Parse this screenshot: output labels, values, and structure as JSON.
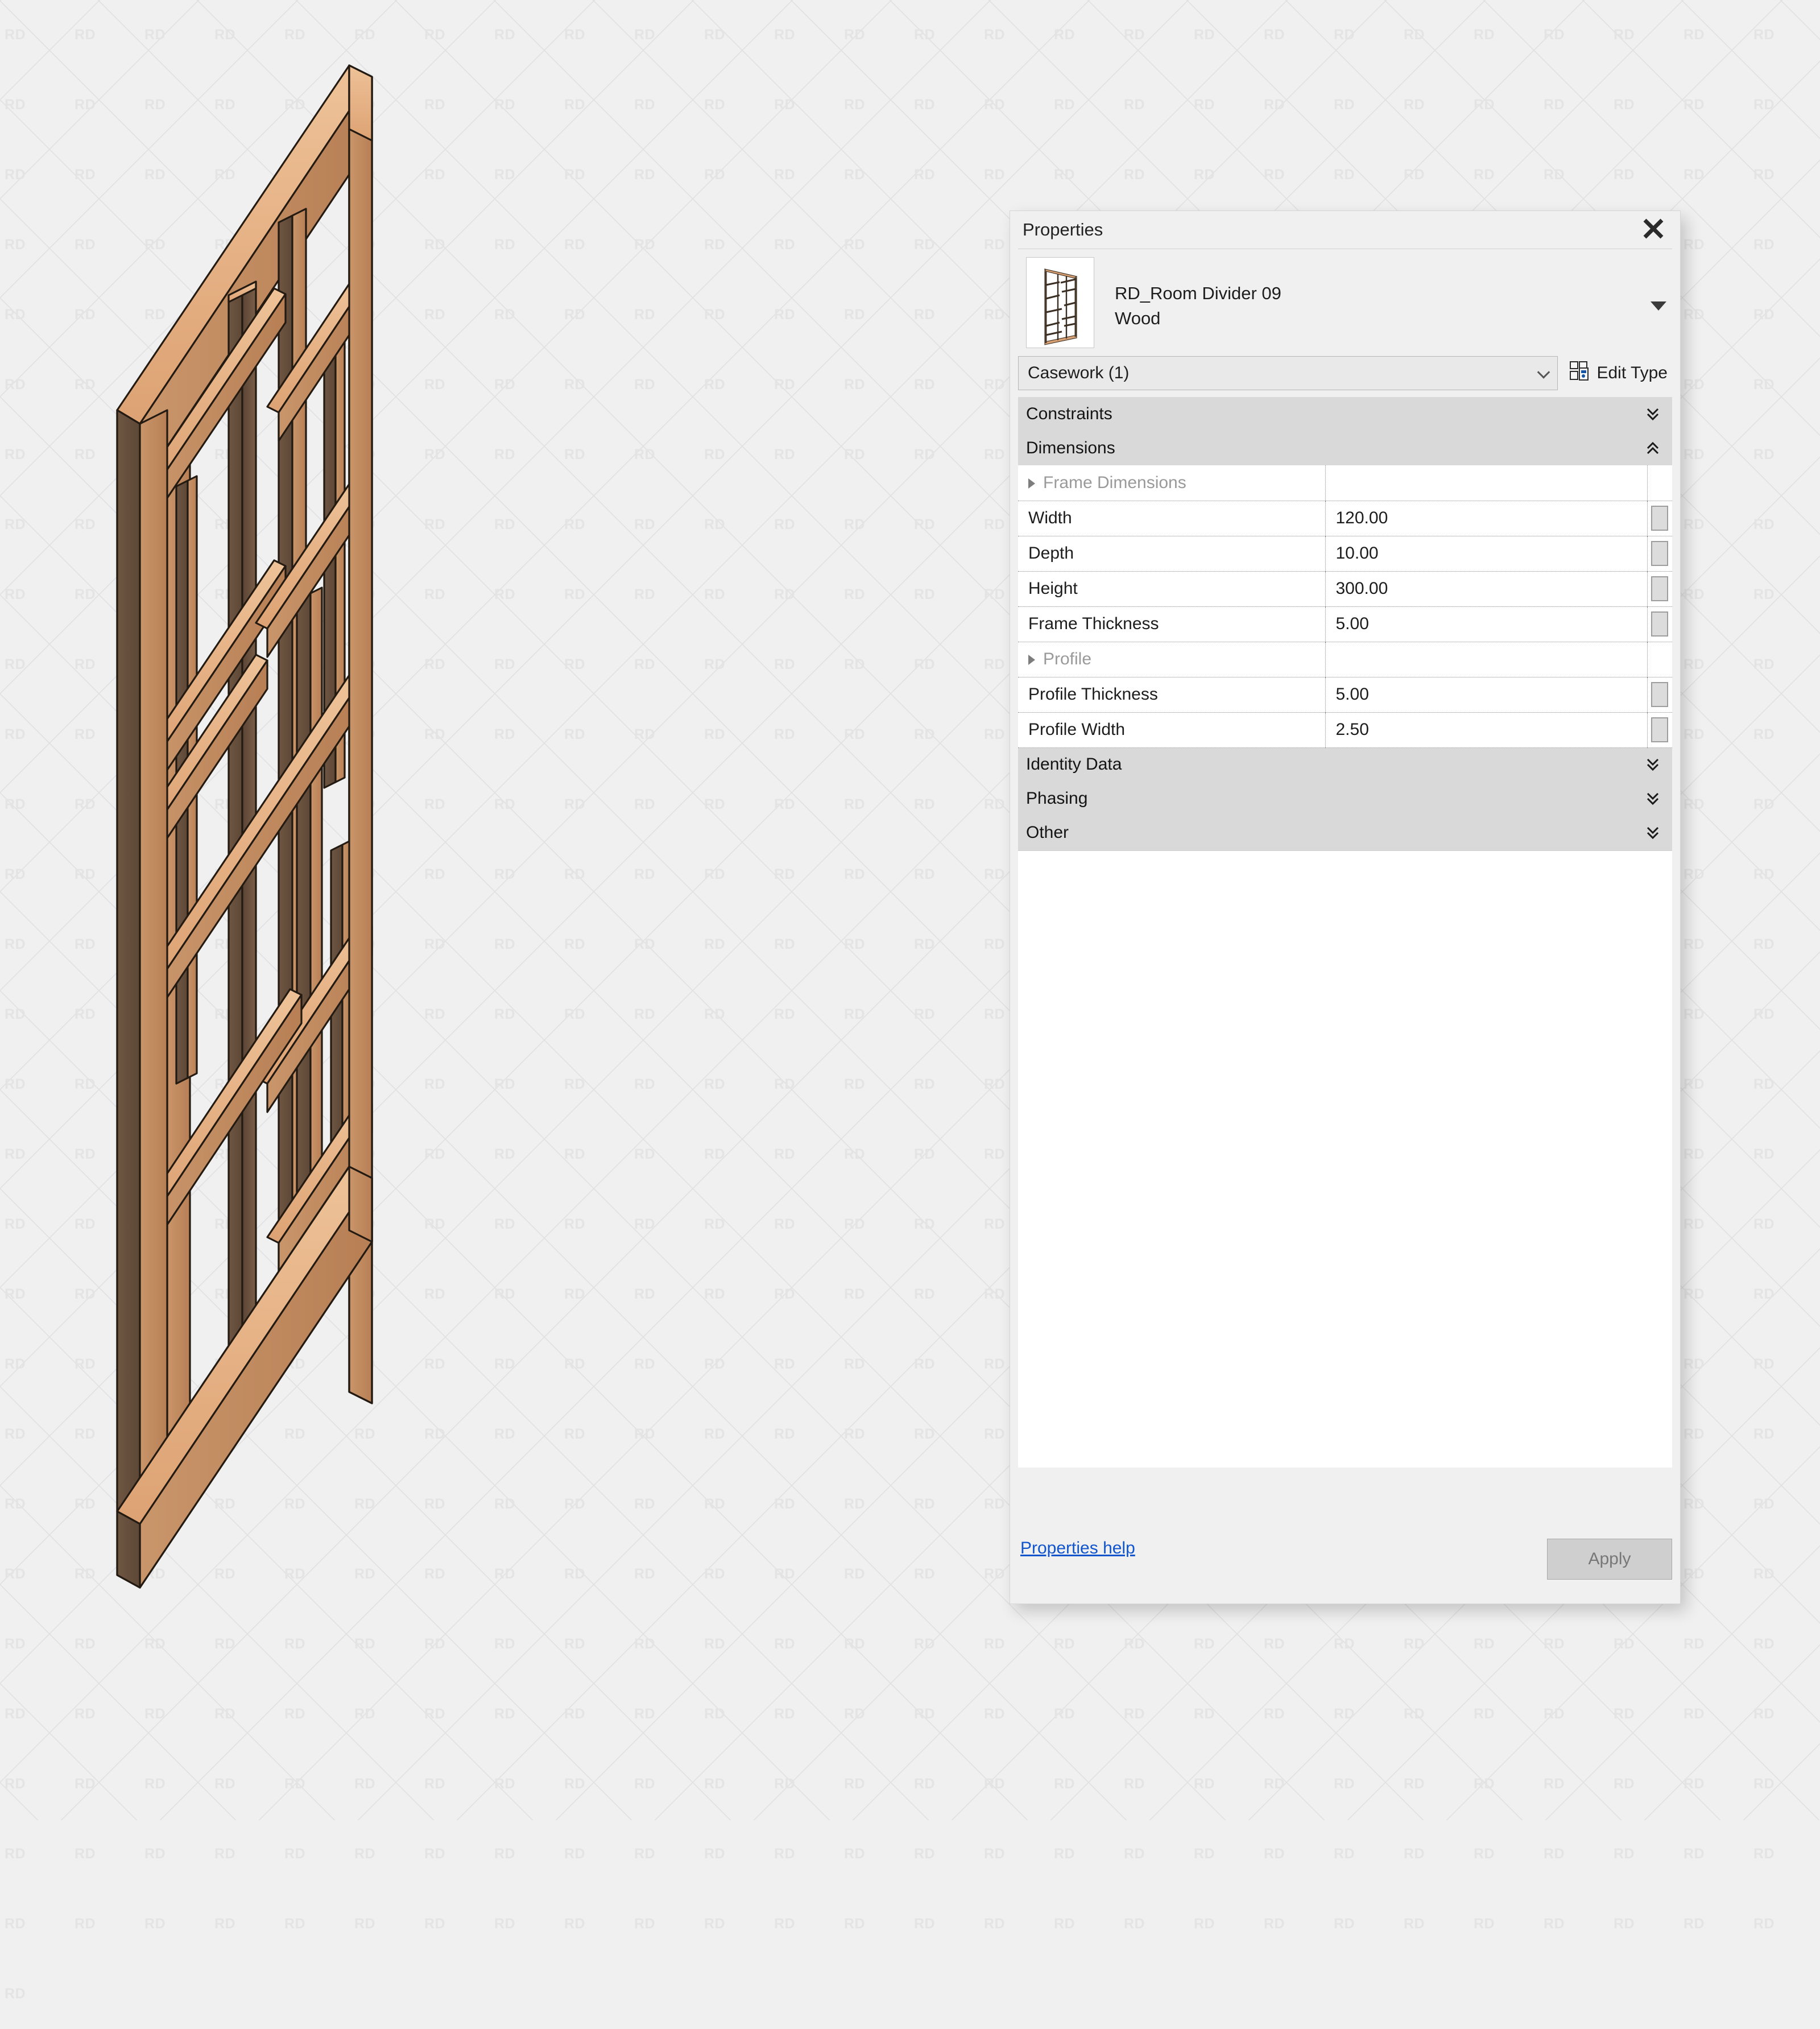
{
  "background": {
    "watermark_text": "RD",
    "bg_color": "#f0f0f1"
  },
  "model": {
    "name": "room-divider-wood-frame",
    "wood_top_color": "#e3ab7c",
    "wood_face_color": "#c08b5f",
    "wood_dark_color": "#6b5340",
    "outline_color": "#2a2018"
  },
  "panel": {
    "title": "Properties",
    "close_icon": "close-icon",
    "type": {
      "name_line1": "RD_Room Divider 09",
      "name_line2": "Wood",
      "thumbnail_icon": "room-divider-thumbnail"
    },
    "category_select": {
      "value": "Casework (1)",
      "chevron_icon": "chevron-down-icon"
    },
    "edit_type": {
      "label": "Edit Type",
      "icon": "edit-type-icon"
    },
    "groups": [
      {
        "label": "Constraints",
        "state": "collapsed",
        "icon": "double-chevron-down-icon"
      },
      {
        "label": "Dimensions",
        "state": "expanded",
        "icon": "double-chevron-up-icon"
      },
      {
        "label": "Identity Data",
        "state": "collapsed",
        "icon": "double-chevron-down-icon"
      },
      {
        "label": "Phasing",
        "state": "collapsed",
        "icon": "double-chevron-down-icon"
      },
      {
        "label": "Other",
        "state": "collapsed",
        "icon": "double-chevron-down-icon"
      }
    ],
    "dimensions_rows": [
      {
        "kind": "subheader",
        "param": "Frame Dimensions",
        "value": ""
      },
      {
        "kind": "value",
        "param": "Width",
        "value": "120.00"
      },
      {
        "kind": "value",
        "param": "Depth",
        "value": "10.00"
      },
      {
        "kind": "value",
        "param": "Height",
        "value": "300.00"
      },
      {
        "kind": "value",
        "param": "Frame Thickness",
        "value": "5.00"
      },
      {
        "kind": "subheader",
        "param": "Profile",
        "value": ""
      },
      {
        "kind": "value",
        "param": "Profile Thickness",
        "value": "5.00"
      },
      {
        "kind": "value",
        "param": "Profile Width",
        "value": "2.50"
      }
    ],
    "footer": {
      "help_link": "Properties help",
      "apply_label": "Apply"
    }
  }
}
